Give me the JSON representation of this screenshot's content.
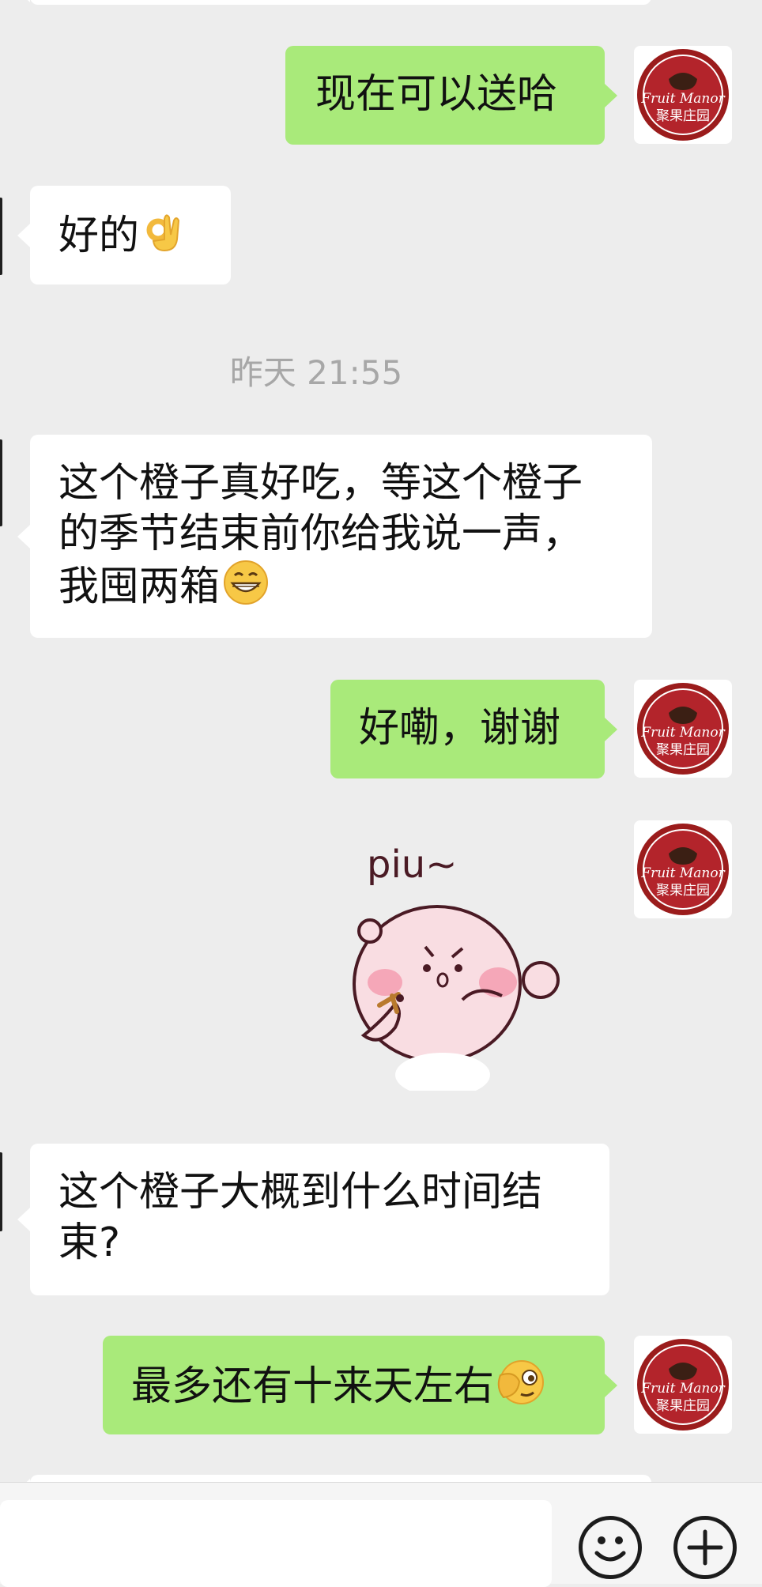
{
  "messages": [
    {
      "id": "m1",
      "side": "out",
      "text": "现在可以送哈",
      "emoji": ""
    },
    {
      "id": "m2",
      "side": "in",
      "text": "好的",
      "emoji": "ok-hand-emoji"
    },
    {
      "id": "m3",
      "side": "in",
      "lines": [
        "这个橙子真好吃，等这个橙子",
        "的季节结束前你给我说一声，",
        "我囤两箱"
      ],
      "emoji": "grin-emoji"
    },
    {
      "id": "m4",
      "side": "out",
      "text": "好嘞，谢谢",
      "emoji": ""
    },
    {
      "id": "m5",
      "side": "out",
      "sticker_text": "piu~"
    },
    {
      "id": "m6",
      "side": "in",
      "lines": [
        "这个橙子大概到什么时间结",
        "束?"
      ],
      "emoji": ""
    },
    {
      "id": "m7",
      "side": "out",
      "text": "最多还有十来天左右",
      "emoji": "peeking-face-emoji"
    }
  ],
  "timestamp": "昨天 21:55",
  "avatar": {
    "brand_en": "Fruit Manor",
    "brand_cn": "聚果庄园",
    "colors": {
      "ring": "#9b1c1c",
      "fill": "#b3242b",
      "text": "#ffffff"
    }
  },
  "input": {
    "value": "",
    "placeholder": ""
  },
  "buttons": {
    "emoji": "smiley-icon",
    "more": "plus-icon"
  },
  "colors": {
    "background": "#ededed",
    "outgoing": "#a9ea7a",
    "incoming": "#ffffff"
  }
}
